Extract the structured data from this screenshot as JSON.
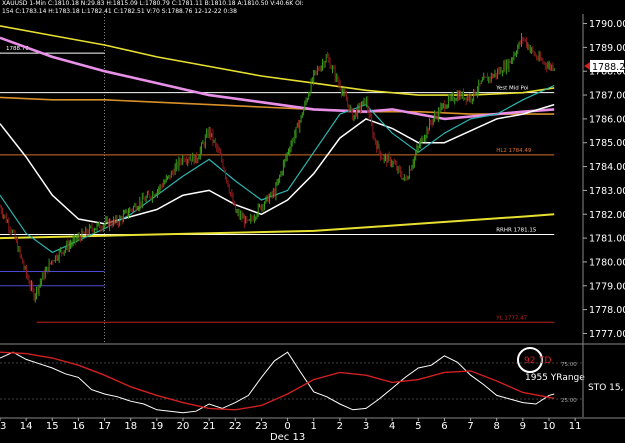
{
  "header": {
    "symbol": "XAUUSD 1-Min",
    "line1": "XAUUSD 1-Min  C:1810.18  N:29.83  H:1815.09  L:1780.79  C:1781.11  B:1810.18  A:1810.50  V:40.6K  OI:",
    "line2": "154  C:1783.14  H:1783.18  L:1782.41  C:1782.51  V:70  S:1788.76  12-12-22  0:38"
  },
  "colors": {
    "background": "#000000",
    "price_bars": "#3a9a1a",
    "price_bars_dark": "#8b1a1a",
    "ma_white": "#ffffff",
    "ma_cyan": "#2bb5b0",
    "ma_pink": "#e890e8",
    "ma_orange": "#d8902a",
    "ma_yellow": "#e8e030",
    "level_orange": "#d8702a",
    "level_blue": "#4a4ad0",
    "level_red": "#c02020",
    "stoch_white": "#ffffff",
    "stoch_red": "#d02020",
    "axis_text": "#ffffff",
    "current_price_marker": "#d02020"
  },
  "chart_data": [
    {
      "type": "line",
      "title": "",
      "xlabel": "",
      "ylabel": "",
      "x_ticks": [
        "13",
        "14",
        "15",
        "16",
        "17",
        "18",
        "19",
        "20",
        "21",
        "22",
        "23",
        "0",
        "1",
        "2",
        "3",
        "4",
        "5",
        "6",
        "7",
        "8",
        "9",
        "10",
        "11"
      ],
      "x_sublabel": "Dec 13",
      "y_ticks": [
        "1790.00",
        "1789.00",
        "1788.00",
        "1787.00",
        "1786.00",
        "1785.00",
        "1784.00",
        "1783.00",
        "1782.00",
        "1781.00",
        "1780.00",
        "1779.00",
        "1778.00",
        "1777.00"
      ],
      "ylim": [
        1776.6,
        1790.4
      ],
      "xlim": [
        13,
        35.3
      ],
      "grid": false,
      "current_price": "1788.22",
      "series": [
        {
          "role": "price_close",
          "x": [
            13,
            13.5,
            14,
            14.3,
            14.6,
            15,
            15.5,
            16,
            16.5,
            17,
            17.5,
            18,
            18.5,
            19,
            19.5,
            20,
            20.5,
            21,
            21.5,
            22,
            22.5,
            23,
            23.5,
            24,
            24.5,
            25,
            25.5,
            26,
            26.5,
            27,
            27.3,
            27.6,
            28,
            28.5,
            29,
            29.5,
            30,
            30.5,
            31,
            31.5,
            32,
            32.5,
            33,
            33.5,
            34,
            34.2
          ],
          "y": [
            1782.3,
            1781.2,
            1779.5,
            1778.6,
            1779.3,
            1780.1,
            1780.6,
            1781.0,
            1781.4,
            1781.6,
            1781.7,
            1782.2,
            1782.6,
            1783.0,
            1783.6,
            1784.4,
            1784.3,
            1785.5,
            1784.2,
            1782.1,
            1781.6,
            1782.4,
            1782.9,
            1784.6,
            1786.0,
            1787.8,
            1788.6,
            1787.4,
            1786.1,
            1786.8,
            1785.2,
            1784.4,
            1784.2,
            1783.4,
            1784.8,
            1785.9,
            1786.6,
            1787.0,
            1786.9,
            1787.6,
            1787.9,
            1788.4,
            1789.4,
            1788.6,
            1788.2,
            1788.22
          ]
        },
        {
          "role": "ma_white",
          "x": [
            13,
            14,
            15,
            16,
            17,
            18,
            19,
            20,
            21,
            22,
            23,
            24,
            25,
            26,
            27,
            28,
            29,
            30,
            31,
            32,
            33,
            34.2
          ],
          "y": [
            1785.8,
            1784.4,
            1782.8,
            1781.8,
            1781.6,
            1781.9,
            1782.2,
            1782.8,
            1783.0,
            1782.4,
            1782.0,
            1782.6,
            1783.7,
            1785.2,
            1786.0,
            1785.6,
            1785.0,
            1785.0,
            1785.5,
            1786.0,
            1786.2,
            1786.6
          ]
        },
        {
          "role": "ma_cyan",
          "x": [
            13,
            14,
            15,
            16,
            17,
            18,
            19,
            20,
            21,
            22,
            23,
            24,
            25,
            26,
            27,
            28,
            29,
            30,
            31,
            32,
            33,
            34.2
          ],
          "y": [
            1782.8,
            1781.2,
            1780.4,
            1780.9,
            1781.4,
            1782.0,
            1782.8,
            1783.6,
            1784.3,
            1783.4,
            1782.6,
            1783.0,
            1784.6,
            1786.2,
            1786.6,
            1785.4,
            1784.6,
            1785.4,
            1786.0,
            1786.2,
            1786.8,
            1787.4
          ]
        },
        {
          "role": "ma_pink",
          "x": [
            13,
            15,
            17,
            19,
            21,
            23,
            25,
            27,
            28,
            29,
            30,
            31,
            32,
            33,
            34.2
          ],
          "y": [
            1789.4,
            1788.6,
            1788.0,
            1787.5,
            1787.0,
            1786.7,
            1786.4,
            1786.3,
            1786.4,
            1786.2,
            1786.0,
            1786.1,
            1786.2,
            1786.3,
            1786.4
          ]
        },
        {
          "role": "ma_yellow_long",
          "x": [
            13,
            15,
            17,
            19,
            21,
            23,
            25,
            27,
            29,
            31,
            33,
            34.2
          ],
          "y": [
            1789.9,
            1789.5,
            1789.1,
            1788.6,
            1788.2,
            1787.8,
            1787.5,
            1787.2,
            1787.0,
            1787.0,
            1787.1,
            1787.3
          ]
        },
        {
          "role": "ma_orange",
          "x": [
            13,
            15,
            17,
            19,
            21,
            23,
            25,
            27,
            29,
            31,
            33,
            34.2
          ],
          "y": [
            1786.9,
            1786.8,
            1786.8,
            1786.7,
            1786.6,
            1786.5,
            1786.4,
            1786.3,
            1786.3,
            1786.2,
            1786.2,
            1786.2
          ]
        },
        {
          "role": "ma_yellow_flat",
          "x": [
            13,
            17,
            21,
            25,
            29,
            33,
            34.2
          ],
          "y": [
            1781.0,
            1781.1,
            1781.2,
            1781.3,
            1781.6,
            1781.9,
            1782.0
          ]
        }
      ],
      "levels": [
        {
          "label": "1788.76",
          "y": 1788.76,
          "x_from": 13,
          "x_to": 17,
          "color_key": "axis_text"
        },
        {
          "label": "Yest Mid Poi",
          "y": 1787.1,
          "x_from": 13,
          "x_to": 34.2,
          "color_key": "axis_text"
        },
        {
          "label": "HL2 1784.49",
          "y": 1784.49,
          "x_from": 13,
          "x_to": 34.2,
          "color_key": "level_orange"
        },
        {
          "label": "RRHR 1781.15",
          "y": 1781.15,
          "x_from": 13,
          "x_to": 34.2,
          "color_key": "axis_text"
        },
        {
          "label": "",
          "y": 1779.6,
          "x_from": 13,
          "x_to": 17,
          "color_key": "level_blue"
        },
        {
          "label": "",
          "y": 1779.0,
          "x_from": 13,
          "x_to": 17,
          "color_key": "level_blue"
        },
        {
          "label": "YL 1777.47",
          "y": 1777.47,
          "x_from": 14.4,
          "x_to": 34.2,
          "color_key": "level_red"
        }
      ],
      "vertical_markers": [
        17
      ]
    },
    {
      "type": "line",
      "title": "",
      "annotation_value": "92",
      "annotation_label": "TD",
      "range_label": "1955 YRange",
      "indicator_label": "STO 15,",
      "y_ticks": [
        "25.00",
        "75.00"
      ],
      "ylim": [
        0,
        100
      ],
      "xlim": [
        13,
        35.3
      ],
      "series": [
        {
          "role": "stoch_fast",
          "x": [
            13,
            13.5,
            14,
            14.5,
            15,
            15.5,
            16,
            16.5,
            17,
            17.5,
            18,
            18.5,
            19,
            19.5,
            20,
            20.5,
            21,
            21.5,
            22,
            22.5,
            23,
            23.5,
            24,
            24.5,
            25,
            25.5,
            26,
            26.5,
            27,
            27.5,
            28,
            28.5,
            29,
            29.5,
            30,
            30.5,
            31,
            31.5,
            32,
            32.5,
            33,
            33.5,
            34,
            34.2
          ],
          "y": [
            82,
            90,
            80,
            74,
            68,
            60,
            55,
            38,
            32,
            28,
            22,
            18,
            10,
            8,
            6,
            8,
            18,
            12,
            20,
            30,
            55,
            78,
            90,
            62,
            35,
            28,
            18,
            10,
            12,
            25,
            40,
            55,
            68,
            72,
            85,
            76,
            58,
            45,
            30,
            25,
            20,
            18,
            30,
            32
          ]
        },
        {
          "role": "stoch_slow",
          "x": [
            13,
            14,
            15,
            16,
            17,
            18,
            19,
            20,
            21,
            22,
            23,
            24,
            25,
            26,
            27,
            28,
            29,
            30,
            31,
            32,
            33,
            34.2
          ],
          "y": [
            90,
            88,
            82,
            72,
            58,
            42,
            30,
            20,
            12,
            10,
            16,
            32,
            52,
            62,
            58,
            48,
            52,
            62,
            64,
            50,
            34,
            26
          ]
        }
      ]
    }
  ]
}
